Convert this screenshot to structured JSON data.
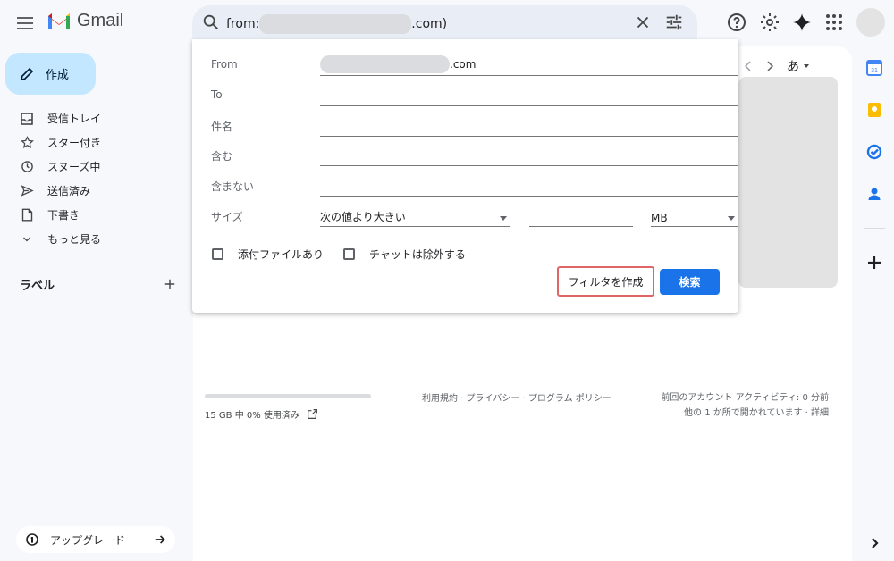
{
  "app": {
    "name": "Gmail"
  },
  "search": {
    "prefix": "from:",
    "suffix": ".com)"
  },
  "compose": {
    "label": "作成"
  },
  "nav": {
    "items": [
      {
        "label": "受信トレイ",
        "icon": "inbox-icon"
      },
      {
        "label": "スター付き",
        "icon": "star-icon"
      },
      {
        "label": "スヌーズ中",
        "icon": "clock-icon"
      },
      {
        "label": "送信済み",
        "icon": "send-icon"
      },
      {
        "label": "下書き",
        "icon": "draft-icon"
      },
      {
        "label": "もっと見る",
        "icon": "chevron-down-icon"
      }
    ],
    "labels_heading": "ラベル"
  },
  "upgrade": {
    "label": "アップグレード"
  },
  "pager": {
    "input_tool": "あ"
  },
  "footer": {
    "storage": "15 GB 中 0% 使用済み",
    "storage_used_percent": 0,
    "links": "利用規約 · プライバシー · プログラム ポリシー",
    "activity_line1": "前回のアカウント アクティビティ: 0 分前",
    "activity_line2": "他の 1 か所で開かれています · 詳細"
  },
  "filter_panel": {
    "from_label": "From",
    "from_value_suffix": ".com",
    "to_label": "To",
    "subject_label": "件名",
    "has_words_label": "含む",
    "not_words_label": "含まない",
    "size_label": "サイズ",
    "size_operator": "次の値より大きい",
    "size_unit": "MB",
    "has_attachment_label": "添付ファイルあり",
    "exclude_chats_label": "チャットは除外する",
    "create_filter_label": "フィルタを作成",
    "search_button_label": "検索"
  },
  "colors": {
    "accent": "#1a73e8",
    "compose_bg": "#c2e7ff",
    "highlight_border": "#e06666",
    "background": "#f6f8fc"
  }
}
